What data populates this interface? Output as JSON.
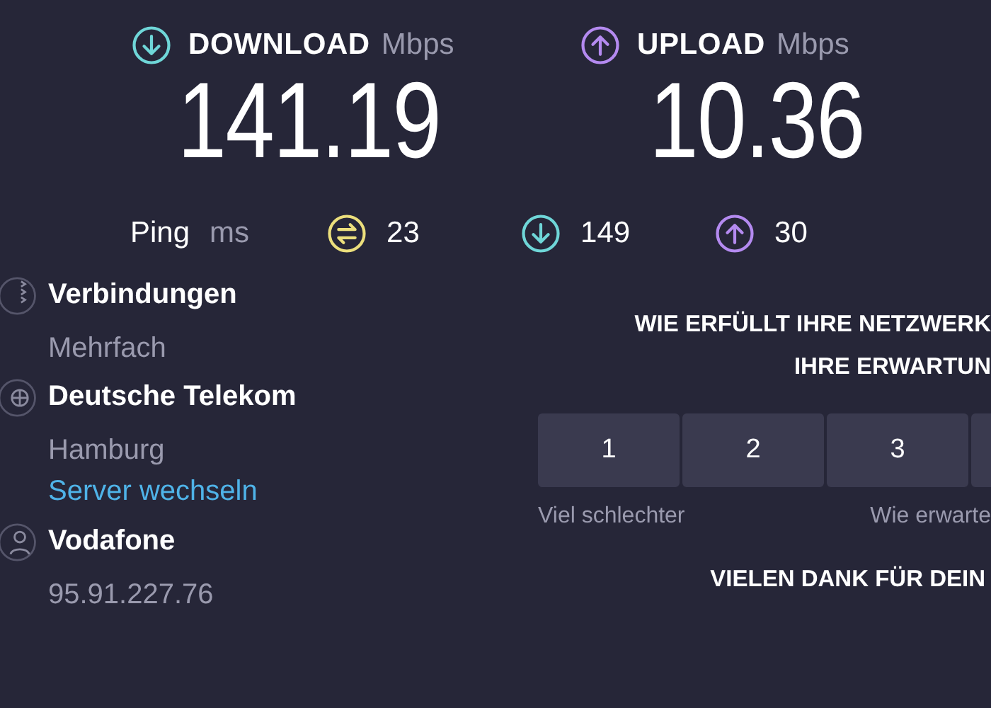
{
  "speeds": [
    {
      "kind": "download",
      "label": "DOWNLOAD",
      "unit": "Mbps",
      "value": "141.19"
    },
    {
      "kind": "upload",
      "label": "UPLOAD",
      "unit": "Mbps",
      "value": "10.36"
    }
  ],
  "ping": {
    "label": "Ping",
    "unit": "ms",
    "items": [
      {
        "kind": "idle",
        "value": "23"
      },
      {
        "kind": "download",
        "value": "149"
      },
      {
        "kind": "upload",
        "value": "30"
      }
    ]
  },
  "connection_info": [
    {
      "kind": "connections",
      "title": "Verbindungen",
      "subtitle": "Mehrfach"
    },
    {
      "kind": "server",
      "title": "Deutsche Telekom",
      "subtitle": "Hamburg",
      "link": "Server wechseln"
    },
    {
      "kind": "provider",
      "title": "Vodafone",
      "subtitle": "95.91.227.76"
    }
  ],
  "survey": {
    "question_lines": [
      "WIE ERFÜLLT IHRE NETZWERK",
      "IHRE ERWARTUN"
    ],
    "ratings": [
      {
        "label": "1",
        "selected": false
      },
      {
        "label": "2",
        "selected": false
      },
      {
        "label": "3",
        "selected": false
      },
      {
        "selected": false
      }
    ],
    "scale_labels": [
      "Viel schlechter",
      "Wie erwarte"
    ],
    "thanks": "VIELEN DANK FÜR DEIN"
  }
}
